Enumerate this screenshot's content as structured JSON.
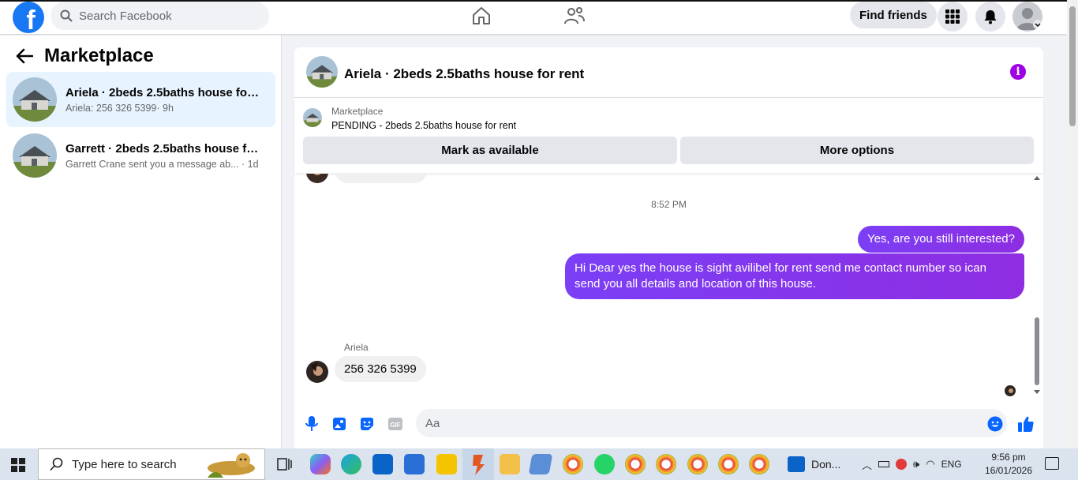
{
  "topbar": {
    "search_placeholder": "Search Facebook",
    "find_friends_label": "Find friends"
  },
  "sidebar": {
    "title": "Marketplace",
    "conversations": [
      {
        "name": "Ariela · 2beds 2.5baths house for r...",
        "preview": "Ariela: 256 326 5399",
        "time": "· 9h",
        "active": true
      },
      {
        "name": "Garrett · 2beds 2.5baths house for ...",
        "preview": "Garrett Crane sent you a message ab...",
        "time": "· 1d",
        "active": false
      }
    ]
  },
  "chat": {
    "title": "Ariela · 2beds 2.5baths house for rent",
    "marketplace_label": "Marketplace",
    "listing_status": "PENDING - 2beds 2.5baths house for rent",
    "mark_available_label": "Mark as available",
    "more_options_label": "More options",
    "timestamp": "8:52 PM",
    "messages_out": [
      "Yes, are you still interested?",
      "Hi Dear yes the house is sight avilibel for rent send me contact number so ican send you all details and location of this house."
    ],
    "incoming_sender": "Ariela",
    "message_in": "256 326 5399",
    "composer_placeholder": "Aa",
    "accent_color": "#a000e4"
  },
  "taskbar": {
    "search_placeholder": "Type here to search",
    "pinned_label": "Don...",
    "language": "ENG",
    "time": "9:56 pm",
    "date": "16/01/2026"
  }
}
